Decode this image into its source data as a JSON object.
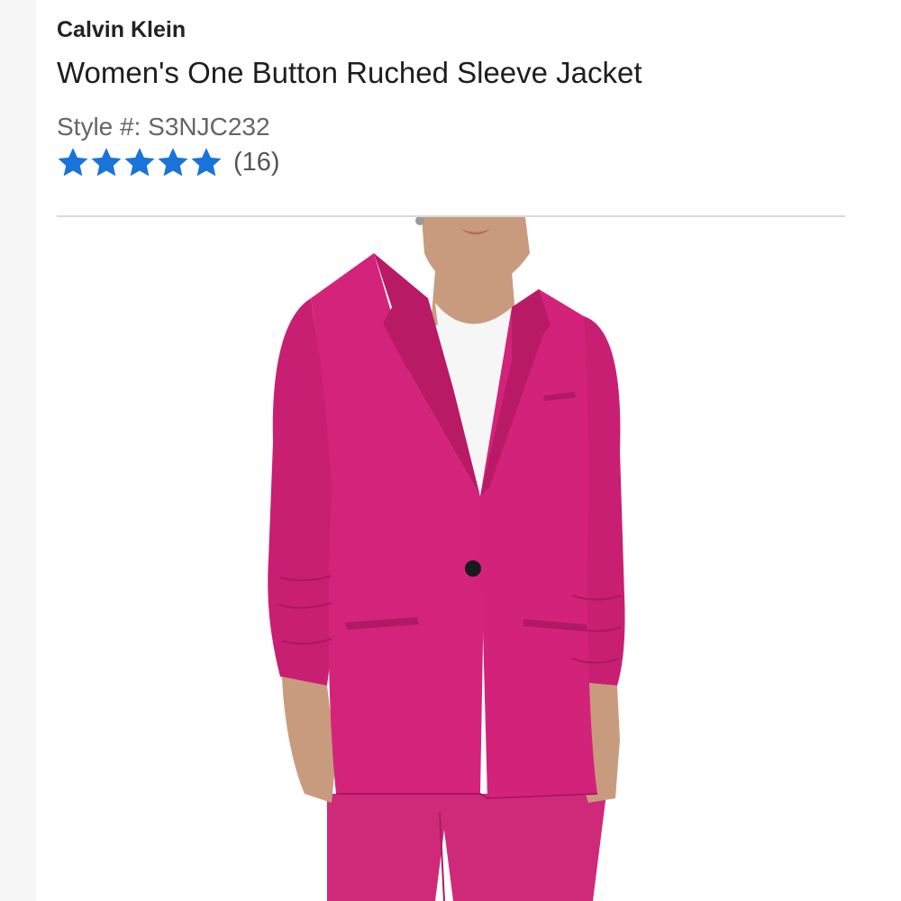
{
  "product": {
    "brand": "Calvin Klein",
    "title": "Women's One Button Ruched Sleeve Jacket",
    "style_label": "Style #: S3NJC232",
    "rating": {
      "stars": 5,
      "review_count": "(16)",
      "star_color": "#1a73d9"
    },
    "image": {
      "subject": "model-wearing-pink-blazer",
      "jacket_color": "#d4237a"
    }
  }
}
